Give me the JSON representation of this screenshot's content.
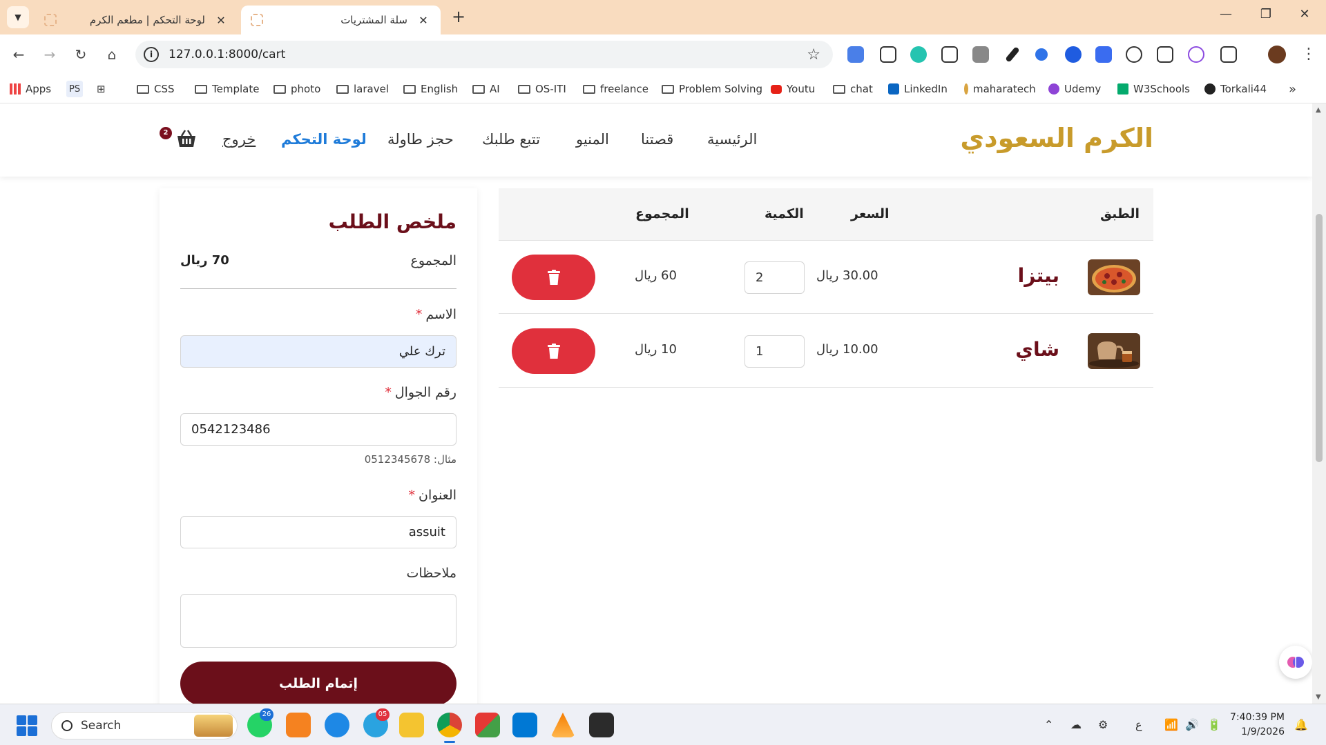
{
  "browser": {
    "tabs": [
      {
        "title": "لوحة التحكم | مطعم الكرم",
        "active": false
      },
      {
        "title": "سلة المشتريات",
        "active": true
      }
    ],
    "url": "127.0.0.1:8000/cart",
    "bookmarks": [
      "Apps",
      "PS",
      "CSS",
      "Template",
      "photo",
      "laravel",
      "English",
      "AI",
      "OS-ITI",
      "freelance",
      "Problem Solving",
      "Youtu",
      "chat",
      "LinkedIn",
      "maharatech",
      "Udemy",
      "W3Schools",
      "Torkali44"
    ]
  },
  "site": {
    "brand": "الكرم السعودي",
    "nav": {
      "home": "الرئيسية",
      "story": "قصتنا",
      "menu": "المنيو",
      "track": "تتبع طلبك",
      "reserve": "حجز طاولة",
      "dashboard": "لوحة التحكم",
      "logout": "خروج"
    },
    "cart_count": "2"
  },
  "cart": {
    "headers": {
      "dish": "الطبق",
      "price": "السعر",
      "qty": "الكمية",
      "total": "المجموع"
    },
    "items": [
      {
        "name": "بيتزا",
        "price": "30.00 ريال",
        "qty": "2",
        "total": "60 ريال",
        "image_icon": "pizza-image"
      },
      {
        "name": "شاي",
        "price": "10.00 ريال",
        "qty": "1",
        "total": "10 ريال",
        "image_icon": "tea-image"
      }
    ]
  },
  "summary": {
    "title": "ملخص الطلب",
    "total_label": "المجموع",
    "total_value": "70 ريال",
    "name_label": "الاسم",
    "name_value": "ترك علي",
    "phone_label": "رقم الجوال",
    "phone_value": "0542123486",
    "phone_hint": "مثال: 0512345678",
    "address_label": "العنوان",
    "address_value": "assuit",
    "notes_label": "ملاحظات",
    "submit": "إتمام الطلب",
    "required_mark": "*"
  },
  "taskbar": {
    "search": "Search",
    "whatsapp_badge": "26",
    "telegram_badge": "05",
    "tray_lang": "ع",
    "time": "7:40:39 PM",
    "date": "1/9/2026"
  },
  "colors": {
    "brand": "#c89b2b",
    "maroon": "#6b0f1a",
    "danger": "#e0303c",
    "active_link": "#1e7bd9"
  }
}
